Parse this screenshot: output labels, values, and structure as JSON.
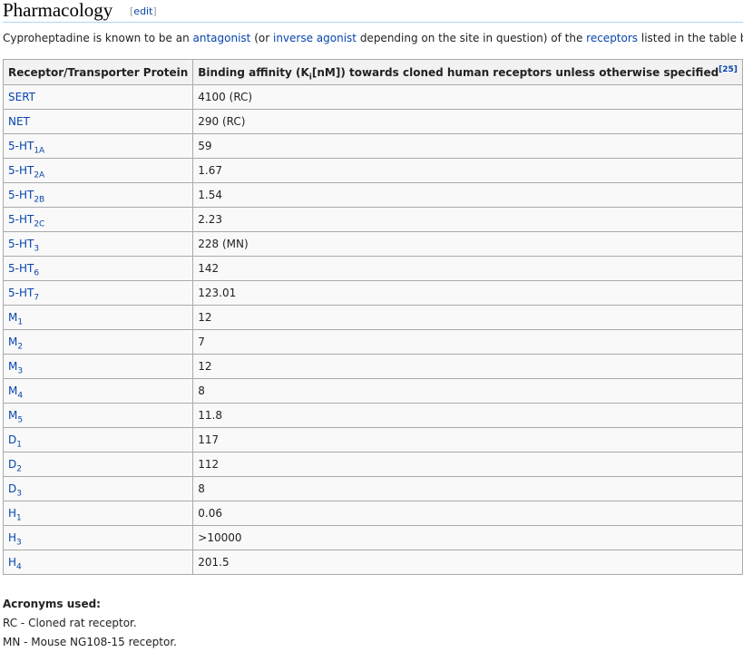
{
  "section": {
    "title": "Pharmacology",
    "edit_open": "[",
    "edit_label": "edit",
    "edit_close": "]"
  },
  "intro": {
    "t1": "Cyproheptadine is known to be an ",
    "l1": "antagonist",
    "t2": " (or ",
    "l2": "inverse agonist",
    "t3": " depending on the site in question) of the ",
    "l3": "receptors",
    "t4": " listed in the table below."
  },
  "table": {
    "col1_header": "Receptor/Transporter Protein",
    "col2_header_pre": "Binding affinity (K",
    "col2_header_sub": "i",
    "col2_header_post": "[nM]) towards cloned human receptors unless otherwise specified",
    "col2_header_ref": "[25]",
    "rows": [
      {
        "name": "SERT",
        "sub": "",
        "value": "4100 (RC)"
      },
      {
        "name": "NET",
        "sub": "",
        "value": "290 (RC)"
      },
      {
        "name": "5-HT",
        "sub": "1A",
        "value": "59"
      },
      {
        "name": "5-HT",
        "sub": "2A",
        "value": "1.67"
      },
      {
        "name": "5-HT",
        "sub": "2B",
        "value": "1.54"
      },
      {
        "name": "5-HT",
        "sub": "2C",
        "value": "2.23"
      },
      {
        "name": "5-HT",
        "sub": "3",
        "value": "228 (MN)"
      },
      {
        "name": "5-HT",
        "sub": "6",
        "value": "142"
      },
      {
        "name": "5-HT",
        "sub": "7",
        "value": "123.01"
      },
      {
        "name": "M",
        "sub": "1",
        "value": "12"
      },
      {
        "name": "M",
        "sub": "2",
        "value": "7"
      },
      {
        "name": "M",
        "sub": "3",
        "value": "12"
      },
      {
        "name": "M",
        "sub": "4",
        "value": "8"
      },
      {
        "name": "M",
        "sub": "5",
        "value": "11.8"
      },
      {
        "name": "D",
        "sub": "1",
        "value": "117"
      },
      {
        "name": "D",
        "sub": "2",
        "value": "112"
      },
      {
        "name": "D",
        "sub": "3",
        "value": "8"
      },
      {
        "name": "H",
        "sub": "1",
        "value": "0.06"
      },
      {
        "name": "H",
        "sub": "3",
        "value": ">10000"
      },
      {
        "name": "H",
        "sub": "4",
        "value": "201.5"
      }
    ]
  },
  "acronyms": {
    "title": "Acronyms used:",
    "items": [
      "RC - Cloned rat receptor.",
      "MN - Mouse NG108-15 receptor."
    ]
  },
  "colors": {
    "link": "#0645ad",
    "border": "#aaaaaa",
    "header_bg": "#f2f2f2",
    "cell_bg": "#f9f9f9"
  }
}
